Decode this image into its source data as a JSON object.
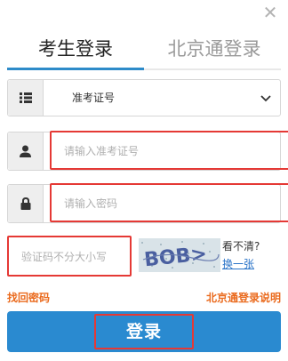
{
  "tabs": {
    "student_login": "考生登录",
    "bjt_login": "北京通登录"
  },
  "id_type": {
    "selected": "准考证号"
  },
  "fields": {
    "exam_number_placeholder": "请输入准考证号",
    "password_placeholder": "请输入密码",
    "captcha_placeholder": "验证码不分大小写"
  },
  "captcha": {
    "image_text": "BOB>",
    "unclear_label": "看不清?",
    "refresh_label": "换一张"
  },
  "links": {
    "forgot_password": "找回密码",
    "bjt_login_help": "北京通登录说明"
  },
  "submit": {
    "label": "登录"
  },
  "icons": {
    "close": "close-icon",
    "list": "list-icon",
    "user": "user-icon",
    "lock": "lock-icon"
  },
  "colors": {
    "accent": "#2a8ad0",
    "highlight_border": "#e53935",
    "link_orange": "#ea6a1d",
    "link_blue": "#2b74c8"
  }
}
